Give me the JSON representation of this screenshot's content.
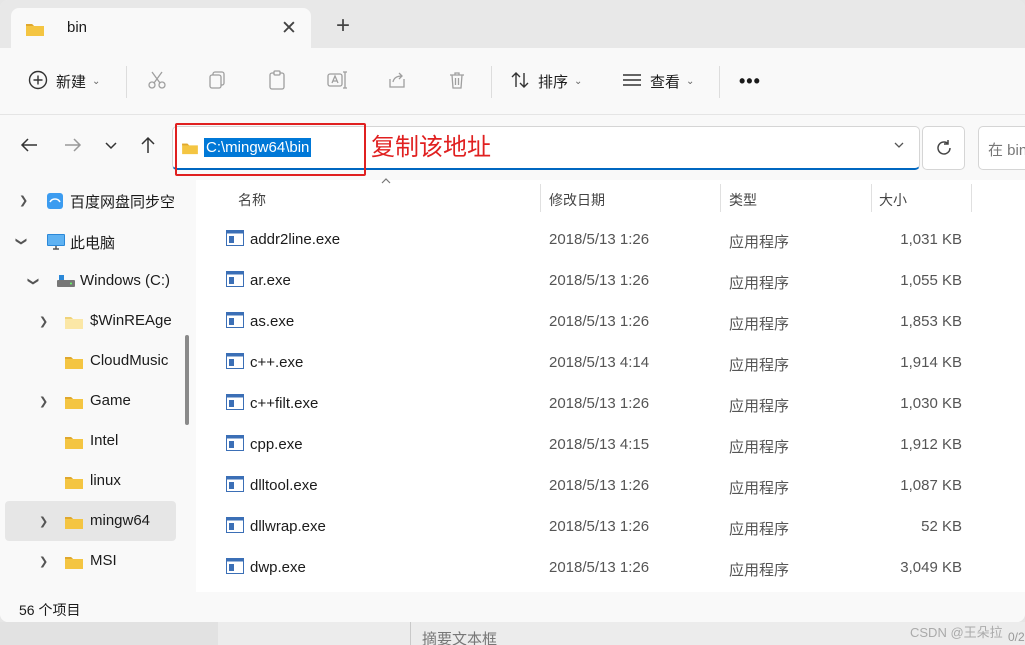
{
  "tab": {
    "title": "bin",
    "close": "✕",
    "new_tab": "+"
  },
  "toolbar": {
    "new_label": "新建",
    "sort_label": "排序",
    "view_label": "查看",
    "more": "•••"
  },
  "address": {
    "path": "C:\\mingw64\\bin",
    "annotation": "复制该地址",
    "search_placeholder": "在 bin"
  },
  "sidebar": {
    "items": [
      {
        "label": "百度网盘同步空"
      },
      {
        "label": "此电脑"
      },
      {
        "label": "Windows (C:)"
      },
      {
        "label": "$WinREAge"
      },
      {
        "label": "CloudMusic"
      },
      {
        "label": "Game"
      },
      {
        "label": "Intel"
      },
      {
        "label": "linux"
      },
      {
        "label": "mingw64"
      },
      {
        "label": "MSI"
      }
    ]
  },
  "columns": {
    "name": "名称",
    "date": "修改日期",
    "type": "类型",
    "size": "大小"
  },
  "files": [
    {
      "name": "addr2line.exe",
      "date": "2018/5/13 1:26",
      "type": "应用程序",
      "size": "1,031 KB"
    },
    {
      "name": "ar.exe",
      "date": "2018/5/13 1:26",
      "type": "应用程序",
      "size": "1,055 KB"
    },
    {
      "name": "as.exe",
      "date": "2018/5/13 1:26",
      "type": "应用程序",
      "size": "1,853 KB"
    },
    {
      "name": "c++.exe",
      "date": "2018/5/13 4:14",
      "type": "应用程序",
      "size": "1,914 KB"
    },
    {
      "name": "c++filt.exe",
      "date": "2018/5/13 1:26",
      "type": "应用程序",
      "size": "1,030 KB"
    },
    {
      "name": "cpp.exe",
      "date": "2018/5/13 4:15",
      "type": "应用程序",
      "size": "1,912 KB"
    },
    {
      "name": "dlltool.exe",
      "date": "2018/5/13 1:26",
      "type": "应用程序",
      "size": "1,087 KB"
    },
    {
      "name": "dllwrap.exe",
      "date": "2018/5/13 1:26",
      "type": "应用程序",
      "size": "52 KB"
    },
    {
      "name": "dwp.exe",
      "date": "2018/5/13 1:26",
      "type": "应用程序",
      "size": "3,049 KB"
    }
  ],
  "status": {
    "item_count": "56 个项目"
  },
  "backdrop": {
    "summary_placeholder": "摘要文本框",
    "watermark": "CSDN @王朵拉",
    "counter": "0/2"
  },
  "colors": {
    "accent": "#0078d7",
    "annotation_red": "#e02020",
    "folder_yellow": "#f4c542"
  }
}
